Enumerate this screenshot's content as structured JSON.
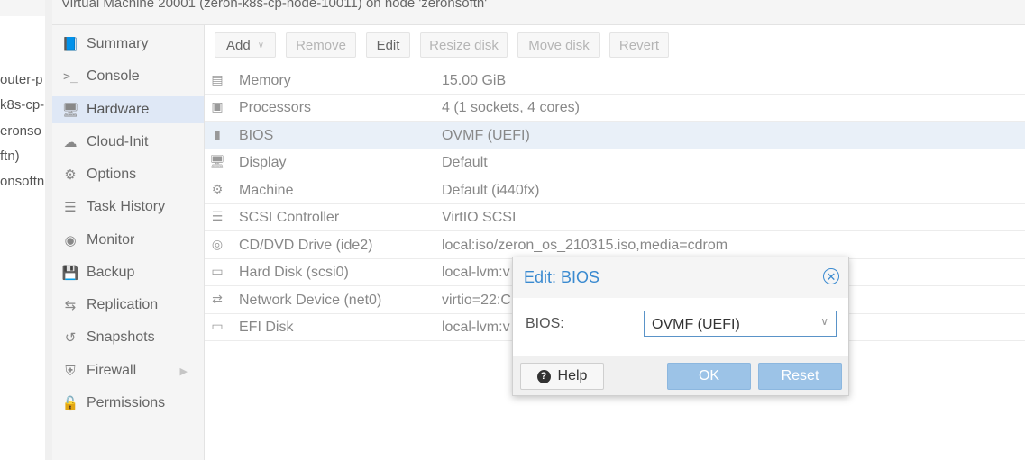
{
  "window": {
    "title": "Virtual Machine 20001 (zeron-k8s-cp-node-10011) on node 'zeronsoftn'"
  },
  "tree": {
    "items": [
      "outer-p",
      "k8s-cp-",
      "eronso",
      "ftn)",
      "onsoftn"
    ]
  },
  "sidenav": {
    "items": [
      {
        "label": "Summary",
        "icon": "book-icon"
      },
      {
        "label": "Console",
        "icon": "terminal-icon"
      },
      {
        "label": "Hardware",
        "icon": "monitor-icon"
      },
      {
        "label": "Cloud-Init",
        "icon": "cloud-icon"
      },
      {
        "label": "Options",
        "icon": "gear-icon"
      },
      {
        "label": "Task History",
        "icon": "list-icon"
      },
      {
        "label": "Monitor",
        "icon": "eye-icon"
      },
      {
        "label": "Backup",
        "icon": "floppy-icon"
      },
      {
        "label": "Replication",
        "icon": "retweet-icon"
      },
      {
        "label": "Snapshots",
        "icon": "history-icon"
      },
      {
        "label": "Firewall",
        "icon": "shield-icon"
      },
      {
        "label": "Permissions",
        "icon": "unlock-icon"
      }
    ],
    "active": "Hardware"
  },
  "toolbar": {
    "add": "Add",
    "remove": "Remove",
    "edit": "Edit",
    "resize": "Resize disk",
    "move": "Move disk",
    "revert": "Revert"
  },
  "hardware": {
    "rows": [
      {
        "name": "Memory",
        "value": "15.00 GiB",
        "icon": "memory-icon"
      },
      {
        "name": "Processors",
        "value": "4 (1 sockets, 4 cores)",
        "icon": "cpu-icon"
      },
      {
        "name": "BIOS",
        "value": "OVMF (UEFI)",
        "icon": "chip-icon"
      },
      {
        "name": "Display",
        "value": "Default",
        "icon": "desktop-icon"
      },
      {
        "name": "Machine",
        "value": "Default (i440fx)",
        "icon": "cogs-icon"
      },
      {
        "name": "SCSI Controller",
        "value": "VirtIO SCSI",
        "icon": "database-icon"
      },
      {
        "name": "CD/DVD Drive (ide2)",
        "value": "local:iso/zeron_os_210315.iso,media=cdrom",
        "icon": "cdrom-icon"
      },
      {
        "name": "Hard Disk (scsi0)",
        "value": "local-lvm:v",
        "icon": "hdd-icon"
      },
      {
        "name": "Network Device (net0)",
        "value": "virtio=22:C",
        "icon": "exchange-icon"
      },
      {
        "name": "EFI Disk",
        "value": "local-lvm:v",
        "icon": "hdd-icon"
      }
    ],
    "selected": "BIOS"
  },
  "dialog": {
    "title": "Edit: BIOS",
    "field_label": "BIOS:",
    "field_value": "OVMF (UEFI)",
    "help": "Help",
    "ok": "OK",
    "reset": "Reset",
    "accent": "#3a8ad0"
  }
}
